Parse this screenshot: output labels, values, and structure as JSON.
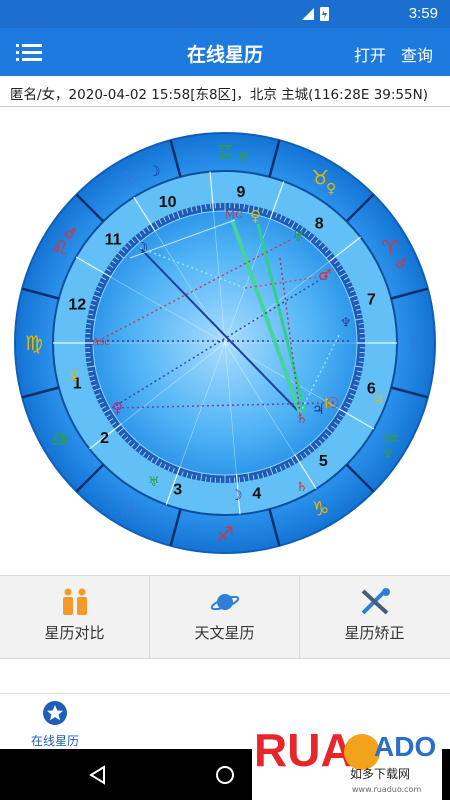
{
  "status_bar": {
    "time": "3:59"
  },
  "app_bar": {
    "title": "在线星历",
    "open_label": "打开",
    "query_label": "查询"
  },
  "info_line": "匿名/女，2020-04-02 15:58[东8区]，北京 主城(116:28E 39:55N)",
  "chart": {
    "houses": [
      "1",
      "2",
      "3",
      "4",
      "5",
      "6",
      "7",
      "8",
      "9",
      "10",
      "11",
      "12"
    ],
    "asc_label": "Asc",
    "mc_label": "MC",
    "zodiac_glyphs": [
      "♓",
      "♈",
      "♉",
      "♊",
      "♋",
      "♌",
      "♍",
      "♎",
      "♏",
      "♐",
      "♑",
      "♒"
    ],
    "colors": {
      "ring": "#1e8fe8",
      "inner": "#5fbdf7",
      "dark_line": "#123f8c"
    }
  },
  "tools": [
    {
      "label": "星历对比",
      "icon": "couple-icon"
    },
    {
      "label": "天文星历",
      "icon": "planet-icon"
    },
    {
      "label": "星历矫正",
      "icon": "tools-icon"
    }
  ],
  "bottom_nav": {
    "label": "在线星历",
    "icon": "star-circle-icon"
  },
  "watermark": {
    "brand": "RUANADO",
    "sub": "如多下载网",
    "url": "www.ruaduo.com"
  }
}
